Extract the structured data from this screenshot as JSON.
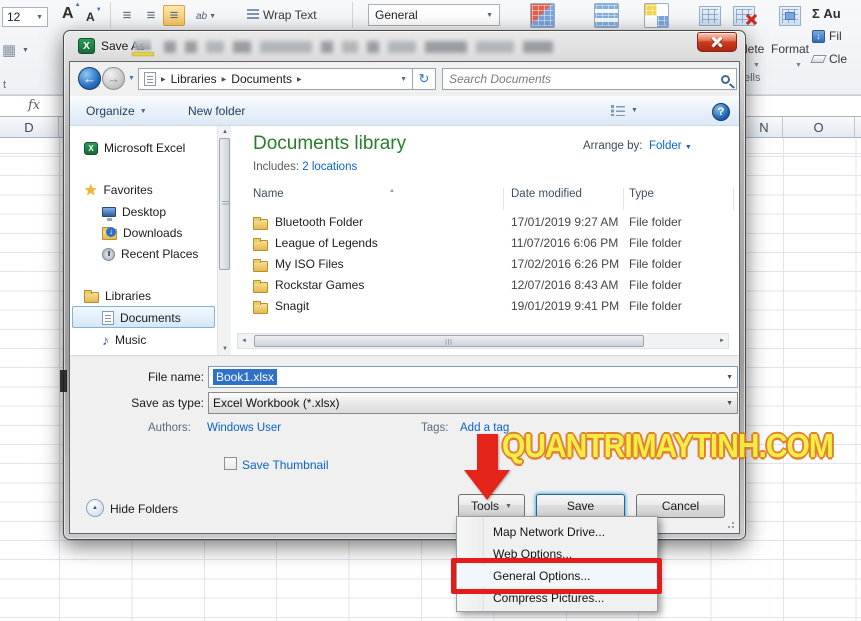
{
  "ribbon": {
    "font_size": "12",
    "wrap_text": "Wrap Text",
    "number_format": "General",
    "delete_partial": "lete",
    "format_label": "Format",
    "autosum_partial": "Σ Au",
    "fill_partial": "Fil",
    "clear_partial": "Cle",
    "cells_partial": "ells",
    "font_group_partial": "t",
    "formula_fx": "fx"
  },
  "grid_headers": {
    "left": "D",
    "right_n": "N",
    "right_o": "O"
  },
  "dialog": {
    "title": "Save As",
    "nav": {
      "breadcrumb_root": "Libraries",
      "breadcrumb_current": "Documents",
      "search_placeholder": "Search Documents"
    },
    "toolbar": {
      "organize": "Organize",
      "new_folder": "New folder"
    },
    "sidebar": {
      "items": [
        {
          "label": "Microsoft Excel"
        },
        {
          "label": "Favorites"
        },
        {
          "label": "Desktop"
        },
        {
          "label": "Downloads"
        },
        {
          "label": "Recent Places"
        },
        {
          "label": "Libraries"
        },
        {
          "label": "Documents"
        },
        {
          "label": "Music"
        }
      ]
    },
    "library": {
      "title": "Documents library",
      "includes_label": "Includes:",
      "includes_link": "2 locations",
      "arrange_label": "Arrange by:",
      "arrange_value": "Folder"
    },
    "files": {
      "headers": [
        "Name",
        "Date modified",
        "Type"
      ],
      "rows": [
        {
          "name": "Bluetooth Folder",
          "date": "17/01/2019 9:27 AM",
          "type": "File folder"
        },
        {
          "name": "League of Legends",
          "date": "11/07/2016 6:06 PM",
          "type": "File folder"
        },
        {
          "name": "My ISO Files",
          "date": "17/02/2016 6:26 PM",
          "type": "File folder"
        },
        {
          "name": "Rockstar Games",
          "date": "12/07/2016 8:43 AM",
          "type": "File folder"
        },
        {
          "name": "Snagit",
          "date": "19/01/2019 9:41 PM",
          "type": "File folder"
        }
      ]
    },
    "fields": {
      "file_name_label": "File name:",
      "file_name_value": "Book1.xlsx",
      "save_type_label": "Save as type:",
      "save_type_value": "Excel Workbook (*.xlsx)",
      "authors_label": "Authors:",
      "authors_value": "Windows User",
      "tags_label": "Tags:",
      "tags_value": "Add a tag",
      "thumbnail_label": "Save Thumbnail"
    },
    "footer": {
      "hide_folders": "Hide Folders",
      "tools": "Tools",
      "save": "Save",
      "cancel": "Cancel"
    },
    "tools_menu": {
      "items": [
        {
          "label": "Map Network Drive..."
        },
        {
          "label": "Web Options..."
        },
        {
          "label": "General Options...",
          "highlighted": true
        },
        {
          "label": "Compress Pictures..."
        }
      ]
    }
  },
  "watermark": "QUANTRIMAYTINH.COM",
  "colors": {
    "library_title_green": "#2a7e2a",
    "link_blue": "#0a63cf",
    "selection_blue": "#2f71c9",
    "annotation_red": "#e31b1b",
    "watermark_yellow": "#f4ee39",
    "watermark_outline": "#e2771d",
    "save_focus_blue": "#55aee2"
  }
}
